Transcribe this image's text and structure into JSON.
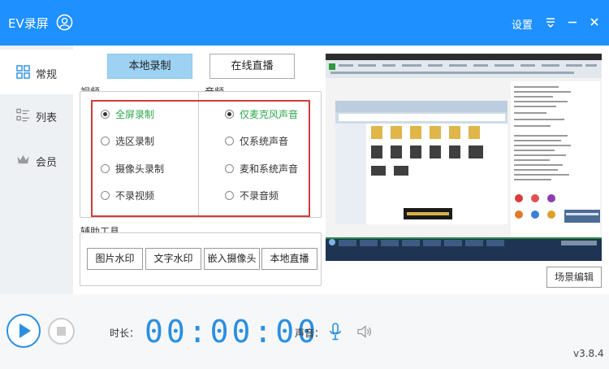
{
  "titlebar": {
    "app_title": "EV录屏",
    "settings_label": "设置"
  },
  "sidebar": {
    "items": [
      {
        "label": "常规"
      },
      {
        "label": "列表"
      },
      {
        "label": "会员"
      }
    ]
  },
  "modes": {
    "local_record": "本地录制",
    "live_stream": "在线直播"
  },
  "video": {
    "section_label": "视频",
    "options": [
      "全屏录制",
      "选区录制",
      "摄像头录制",
      "不录视频"
    ],
    "selected": "全屏录制"
  },
  "audio": {
    "section_label": "音频",
    "options": [
      "仅麦克风声音",
      "仅系统声音",
      "麦和系统声音",
      "不录音频"
    ],
    "selected": "仅麦克风声音"
  },
  "tools": {
    "section_label": "辅助工具",
    "buttons": [
      "图片水印",
      "文字水印",
      "嵌入摄像头",
      "本地直播"
    ]
  },
  "preview": {
    "scene_edit_label": "场景编辑"
  },
  "bottom": {
    "duration_label": "时长：",
    "timer": "00:00:00",
    "volume_label": "声音：",
    "version": "v3.8.4"
  },
  "colors": {
    "title_blue": "#1e90ff",
    "accent_blue": "#2b8fe0",
    "selected_green": "#2aa84a",
    "highlight_red": "#d23b3b",
    "active_mode_blue": "#9ed2f3"
  }
}
